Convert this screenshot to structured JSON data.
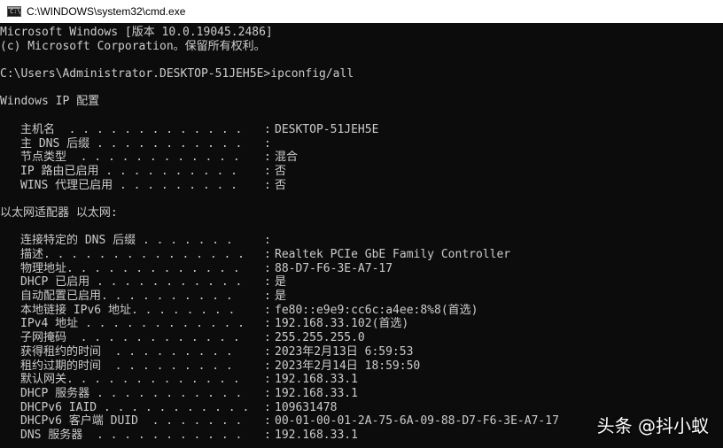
{
  "window": {
    "title": "C:\\WINDOWS\\system32\\cmd.exe",
    "icon_name": "cmd-icon",
    "icon_glyph": "C:\\"
  },
  "console": {
    "header": [
      "Microsoft Windows [版本 10.0.19045.2486]",
      "(c) Microsoft Corporation。保留所有权利。"
    ],
    "prompt": "C:\\Users\\Administrator.DESKTOP-51JEH5E>ipconfig/all",
    "section_windows_ip": "Windows IP 配置",
    "windows_ip": [
      {
        "label": "主机名  . . . . . . . . . . . . .",
        "value": "DESKTOP-51JEH5E"
      },
      {
        "label": "主 DNS 后缀 . . . . . . . . . . .",
        "value": ""
      },
      {
        "label": "节点类型  . . . . . . . . . . . .",
        "value": "混合"
      },
      {
        "label": "IP 路由已启用 . . . . . . . . . .",
        "value": "否"
      },
      {
        "label": "WINS 代理已启用 . . . . . . . . .",
        "value": "否"
      }
    ],
    "section_ethernet": "以太网适配器 以太网:",
    "ethernet": [
      {
        "label": "连接特定的 DNS 后缀 . . . . . . .",
        "value": ""
      },
      {
        "label": "描述. . . . . . . . . . . . . . .",
        "value": "Realtek PCIe GbE Family Controller"
      },
      {
        "label": "物理地址. . . . . . . . . . . . .",
        "value": "88-D7-F6-3E-A7-17"
      },
      {
        "label": "DHCP 已启用 . . . . . . . . . . .",
        "value": "是"
      },
      {
        "label": "自动配置已启用. . . . . . . . . .",
        "value": "是"
      },
      {
        "label": "本地链接 IPv6 地址. . . . . . . .",
        "value": "fe80::e9e9:cc6c:a4ee:8%8(首选)"
      },
      {
        "label": "IPv4 地址 . . . . . . . . . . . .",
        "value": "192.168.33.102(首选)"
      },
      {
        "label": "子网掩码  . . . . . . . . . . . .",
        "value": "255.255.255.0"
      },
      {
        "label": "获得租约的时间  . . . . . . . . .",
        "value": "2023年2月13日 6:59:53"
      },
      {
        "label": "租约过期的时间  . . . . . . . . .",
        "value": "2023年2月14日 18:59:50"
      },
      {
        "label": "默认网关. . . . . . . . . . . . .",
        "value": "192.168.33.1"
      },
      {
        "label": "DHCP 服务器 . . . . . . . . . . .",
        "value": "192.168.33.1"
      },
      {
        "label": "DHCPv6 IAID . . . . . . . . . . .",
        "value": "109631478"
      },
      {
        "label": "DHCPv6 客户端 DUID  . . . . . . .",
        "value": "00-01-00-01-2A-75-6A-09-88-D7-F6-3E-A7-17"
      },
      {
        "label": "DNS 服务器  . . . . . . . . . . .",
        "value": "192.168.33.1"
      }
    ],
    "separator": ":"
  },
  "watermark": "头条 @抖小蚁",
  "colors": {
    "console_bg": "#0c0c0c",
    "console_text": "#cccccc",
    "titlebar_bg": "#ffffff"
  }
}
